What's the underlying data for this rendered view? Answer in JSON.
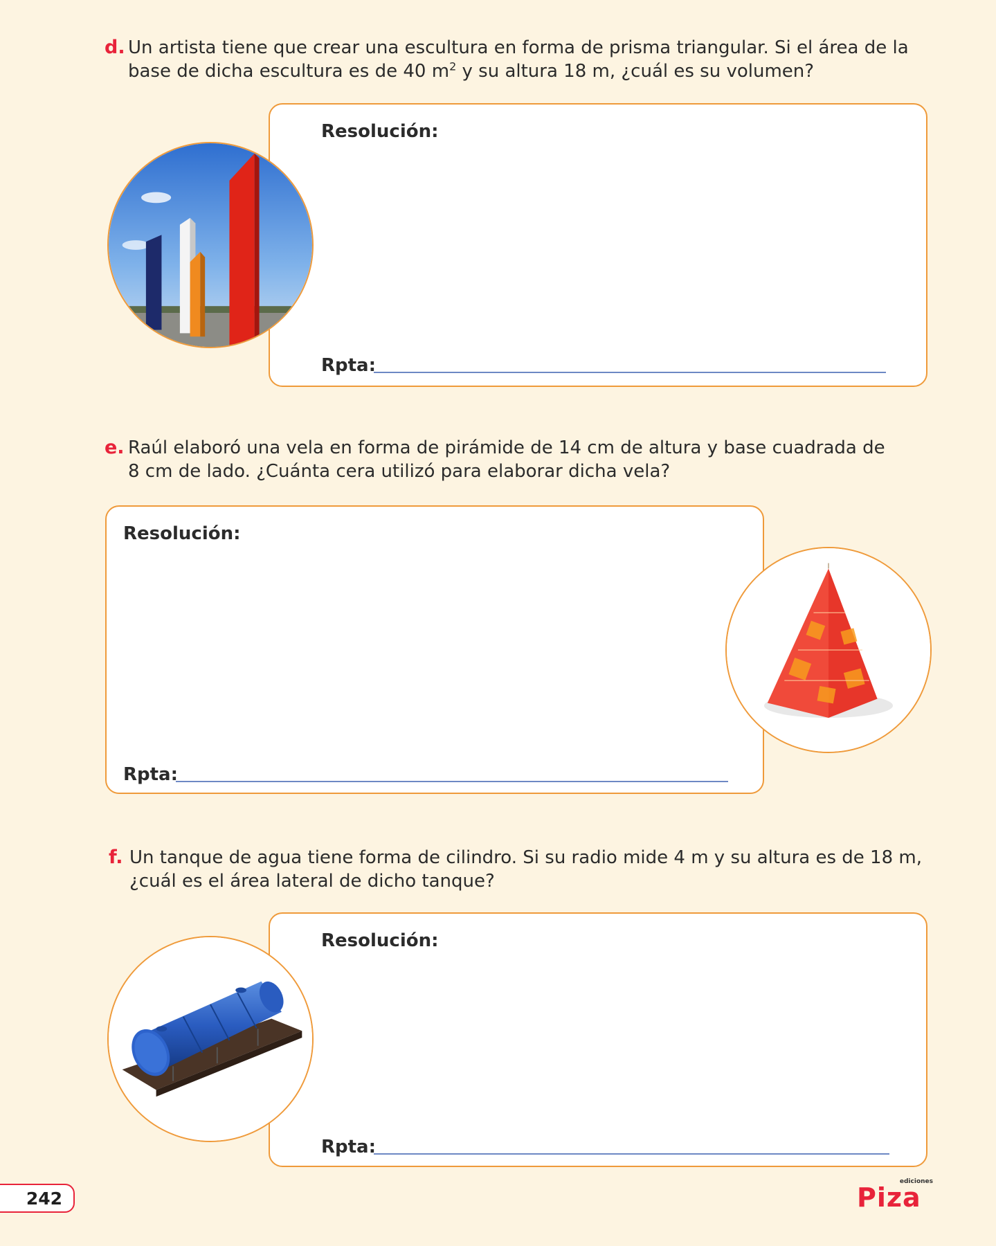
{
  "problems": [
    {
      "letter": "d.",
      "line1": "Un artista tiene que crear una escultura en forma de prisma triangular. Si el área de la",
      "line2_a": "base de dicha escultura es de 40 m",
      "line2_sup": "2",
      "line2_b": " y su altura 18 m, ¿cuál es su volumen?",
      "resolution_label": "Resolución:",
      "answer_label": "Rpta:",
      "image_icon": "sculpture-towers-photo"
    },
    {
      "letter": "e.",
      "line1": "Raúl elaboró una vela en forma de pirámide de 14 cm de altura y base cuadrada de",
      "line2": "8 cm de lado. ¿Cuánta cera utilizó para elaborar dicha vela?",
      "resolution_label": "Resolución:",
      "answer_label": "Rpta:",
      "image_icon": "pyramid-candle-photo"
    },
    {
      "letter": "f.",
      "line1": "Un tanque de agua tiene forma de cilindro. Si su radio mide 4 m y su altura es de 18 m,",
      "line2": "¿cuál es el área lateral de dicho tanque?",
      "resolution_label": "Resolución:",
      "answer_label": "Rpta:",
      "image_icon": "water-tank-photo"
    }
  ],
  "footer": {
    "page_number": "242",
    "logo_small": "ediciones",
    "logo_main": "Piza"
  },
  "colors": {
    "background": "#fdf4e1",
    "accent_orange": "#ef9a3a",
    "accent_red": "#e8233a",
    "answer_line": "#6d88c4"
  }
}
